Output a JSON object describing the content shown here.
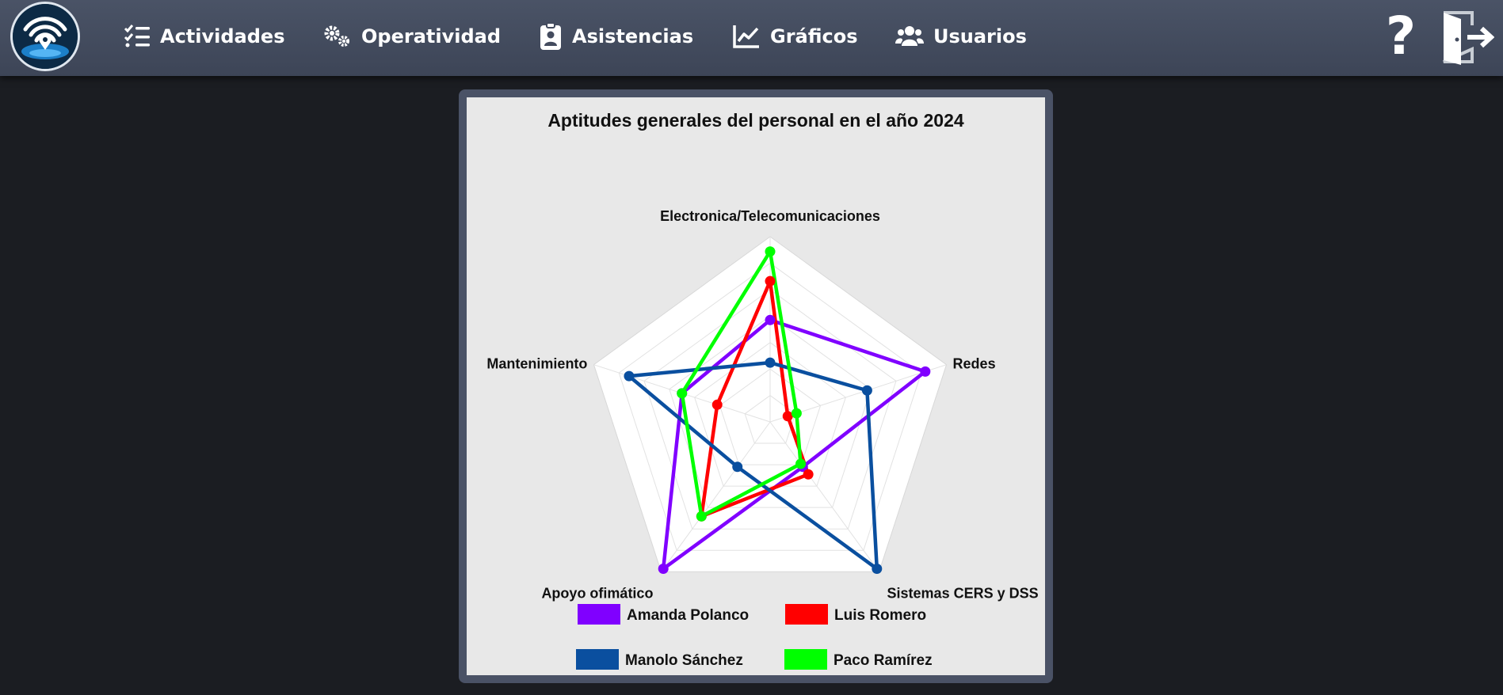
{
  "nav": {
    "items": [
      {
        "label": "Actividades",
        "icon": "list-check-icon"
      },
      {
        "label": "Operatividad",
        "icon": "gears-icon"
      },
      {
        "label": "Asistencias",
        "icon": "clipboard-user-icon"
      },
      {
        "label": "Gráficos",
        "icon": "chart-line-icon"
      },
      {
        "label": "Usuarios",
        "icon": "users-icon"
      }
    ],
    "help_label": "?",
    "logout_icon": "door-exit-icon"
  },
  "colors": {
    "topbar": "#434b5e",
    "background": "#1b1d22",
    "card_border": "#4a5266"
  },
  "chart_data": {
    "type": "radar",
    "title": "Aptitudes generales del personal en el año 2024",
    "axes": [
      "Electronica/Telecomunicaciones",
      "Redes",
      "Sistemas CERS y DSS",
      "Apoyo ofimático",
      "Mantenimiento"
    ],
    "rmax": 10,
    "grid_levels": 7,
    "series": [
      {
        "name": "Amanda Polanco",
        "color": "#8000ff",
        "values": [
          5.5,
          8.8,
          3.0,
          9.8,
          5.0
        ]
      },
      {
        "name": "Luis Romero",
        "color": "#ff0000",
        "values": [
          7.6,
          1.0,
          3.5,
          6.3,
          3.0
        ]
      },
      {
        "name": "Manolo Sánchez",
        "color": "#0a4f9f",
        "values": [
          3.2,
          5.5,
          9.8,
          3.0,
          8.0
        ]
      },
      {
        "name": "Paco Ramírez",
        "color": "#00ff00",
        "values": [
          9.2,
          1.5,
          2.8,
          6.3,
          5.0
        ]
      }
    ]
  }
}
